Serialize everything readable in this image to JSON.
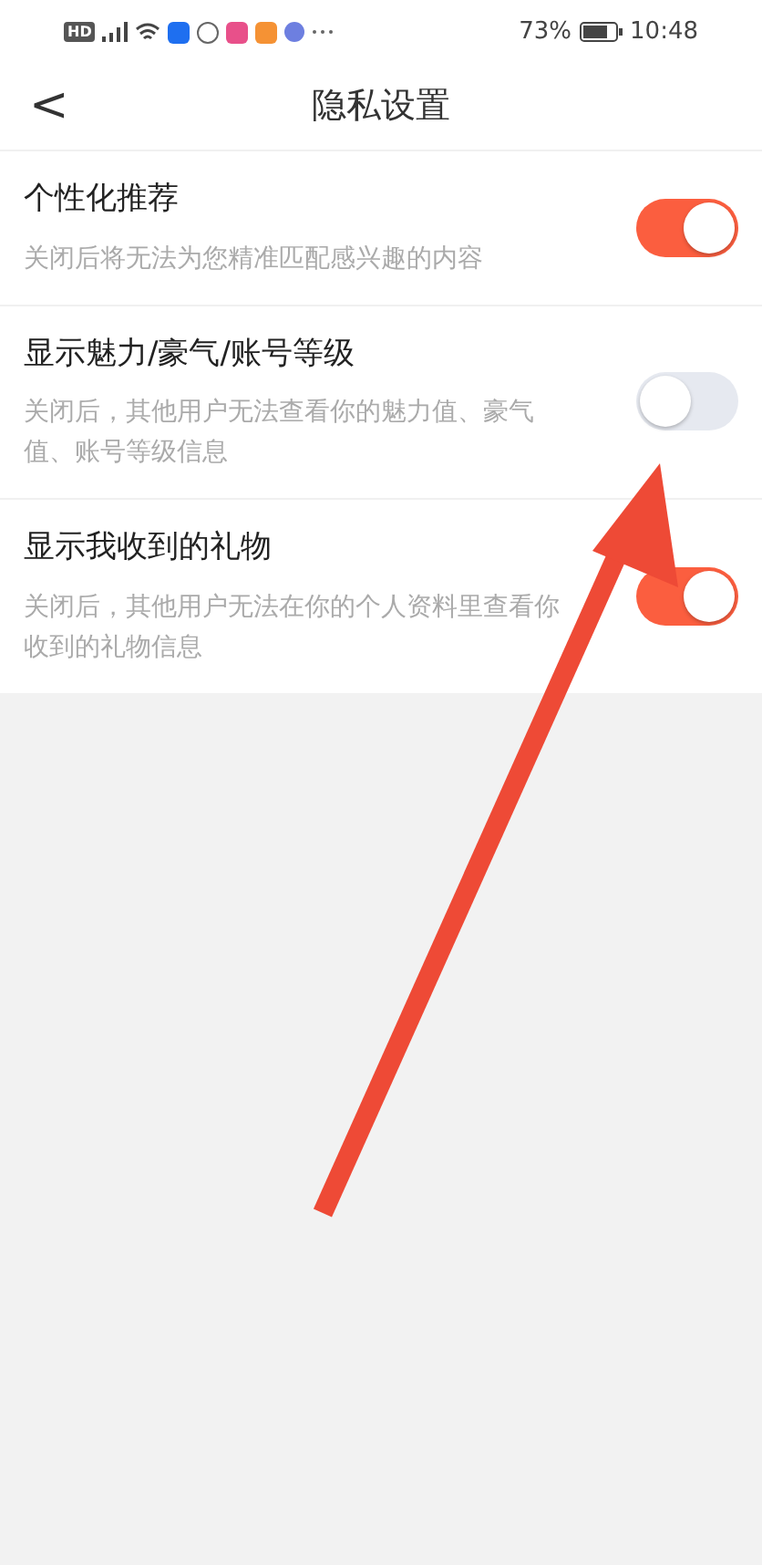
{
  "status_bar": {
    "network_badge": "HD",
    "battery": "73%",
    "time": "10:48"
  },
  "header": {
    "back": "<",
    "title": "隐私设置"
  },
  "settings": [
    {
      "title": "个性化推荐",
      "description": "关闭后将无法为您精准匹配感兴趣的内容",
      "on": true
    },
    {
      "title": "显示魅力/豪气/账号等级",
      "description": "关闭后，其他用户无法查看你的魅力值、豪气值、账号等级信息",
      "on": false
    },
    {
      "title": "显示我收到的礼物",
      "description": "关闭后，其他用户无法在你的个人资料里查看你收到的礼物信息",
      "on": true
    }
  ]
}
